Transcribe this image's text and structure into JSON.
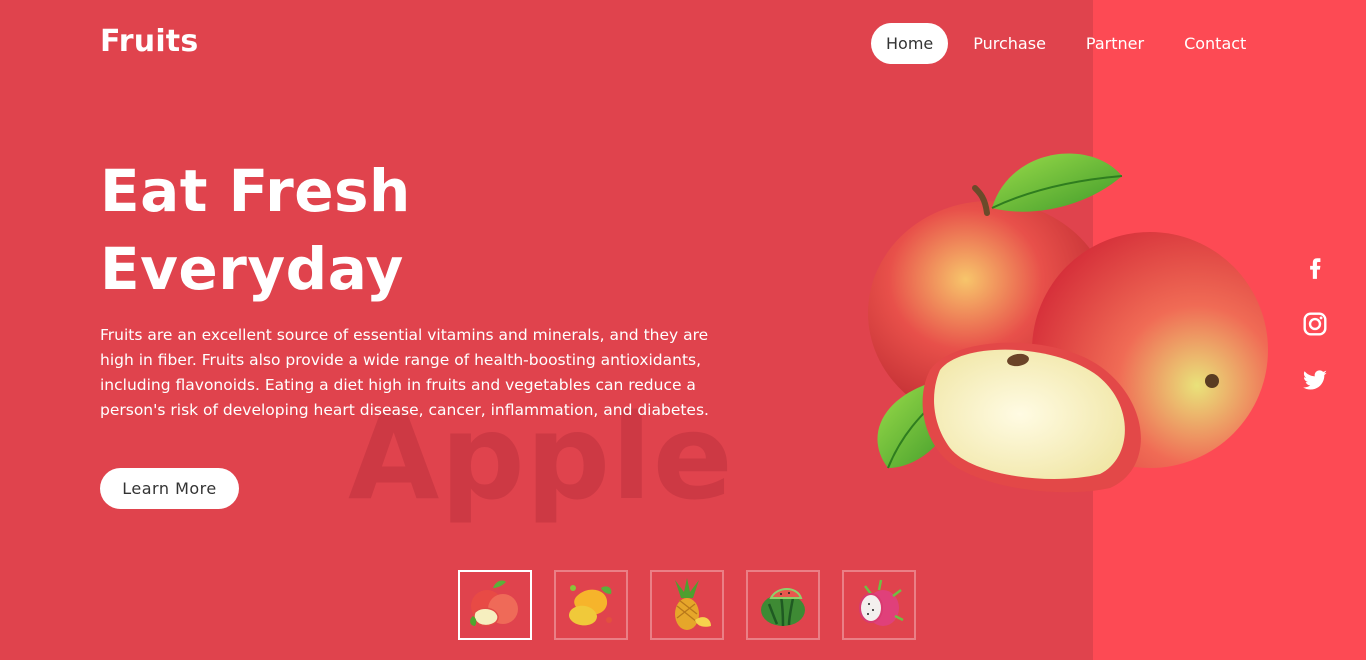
{
  "brand": {
    "logo": "Fruits"
  },
  "nav": {
    "items": [
      {
        "label": "Home",
        "active": true
      },
      {
        "label": "Purchase",
        "active": false
      },
      {
        "label": "Partner",
        "active": false
      },
      {
        "label": "Contact",
        "active": false
      }
    ]
  },
  "hero": {
    "headline": [
      "Eat Fresh",
      "Everyday"
    ],
    "description": "Fruits are an excellent source of essential vitamins and minerals, and they are high in fiber. Fruits also provide a wide range of health-boosting antioxidants, including flavonoids. Eating a diet high in fruits and vegetables can reduce a person's risk of developing heart disease, cancer, inflammation, and diabetes.",
    "button_label": "Learn More",
    "watermark": "Apple"
  },
  "social": [
    "facebook-icon",
    "instagram-icon",
    "twitter-icon"
  ],
  "thumbnails": [
    {
      "name": "apple",
      "active": true
    },
    {
      "name": "mango",
      "active": false
    },
    {
      "name": "pineapple",
      "active": false
    },
    {
      "name": "watermelon",
      "active": false
    },
    {
      "name": "dragon-fruit",
      "active": false
    }
  ],
  "colors": {
    "background": "#e0434d",
    "right_panel": "#fd4a54",
    "text": "#ffffff",
    "button_text": "#333333"
  }
}
